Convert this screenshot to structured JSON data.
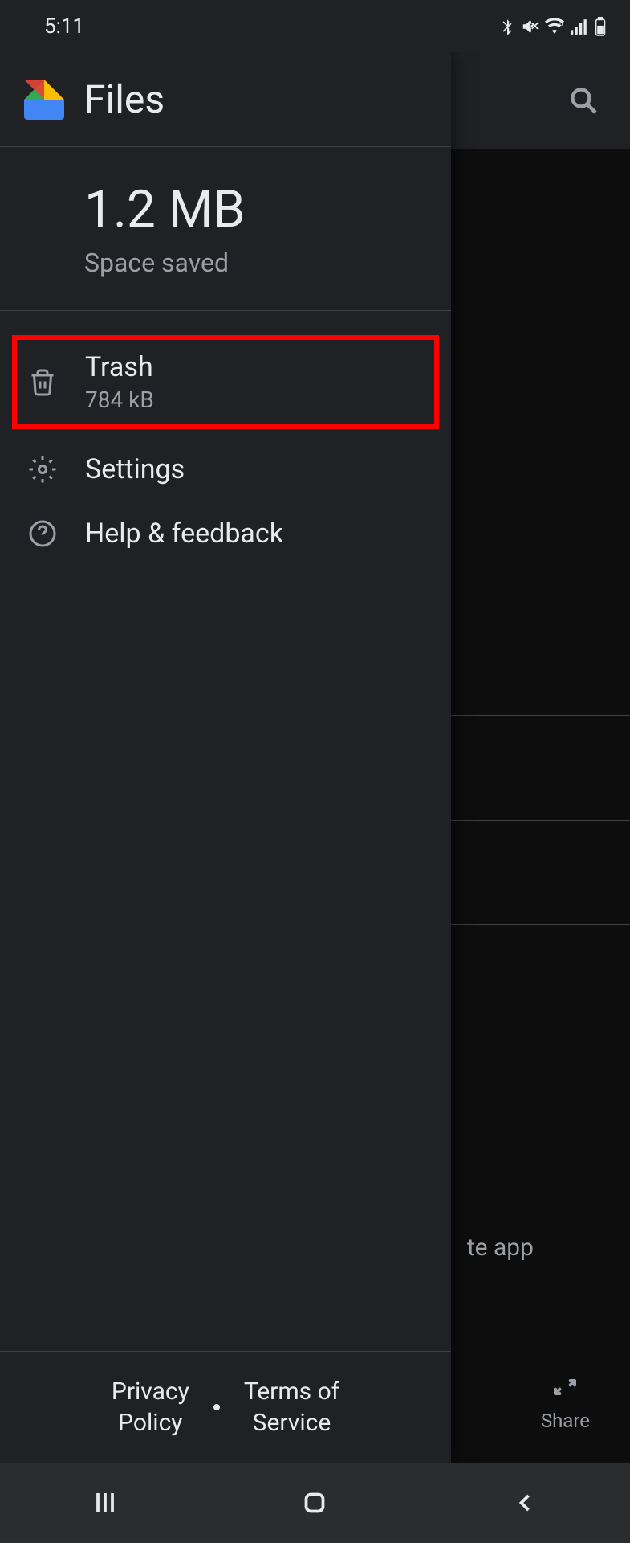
{
  "status": {
    "time": "5:11"
  },
  "drawer": {
    "title": "Files",
    "space": {
      "value": "1.2 MB",
      "label": "Space saved"
    },
    "menu": [
      {
        "label": "Trash",
        "sublabel": "784 kB"
      },
      {
        "label": "Settings"
      },
      {
        "label": "Help & feedback"
      }
    ],
    "footer": {
      "privacy": "Privacy\nPolicy",
      "terms": "Terms of\nService"
    }
  },
  "background": {
    "partial_text": "te app",
    "share": "Share"
  }
}
